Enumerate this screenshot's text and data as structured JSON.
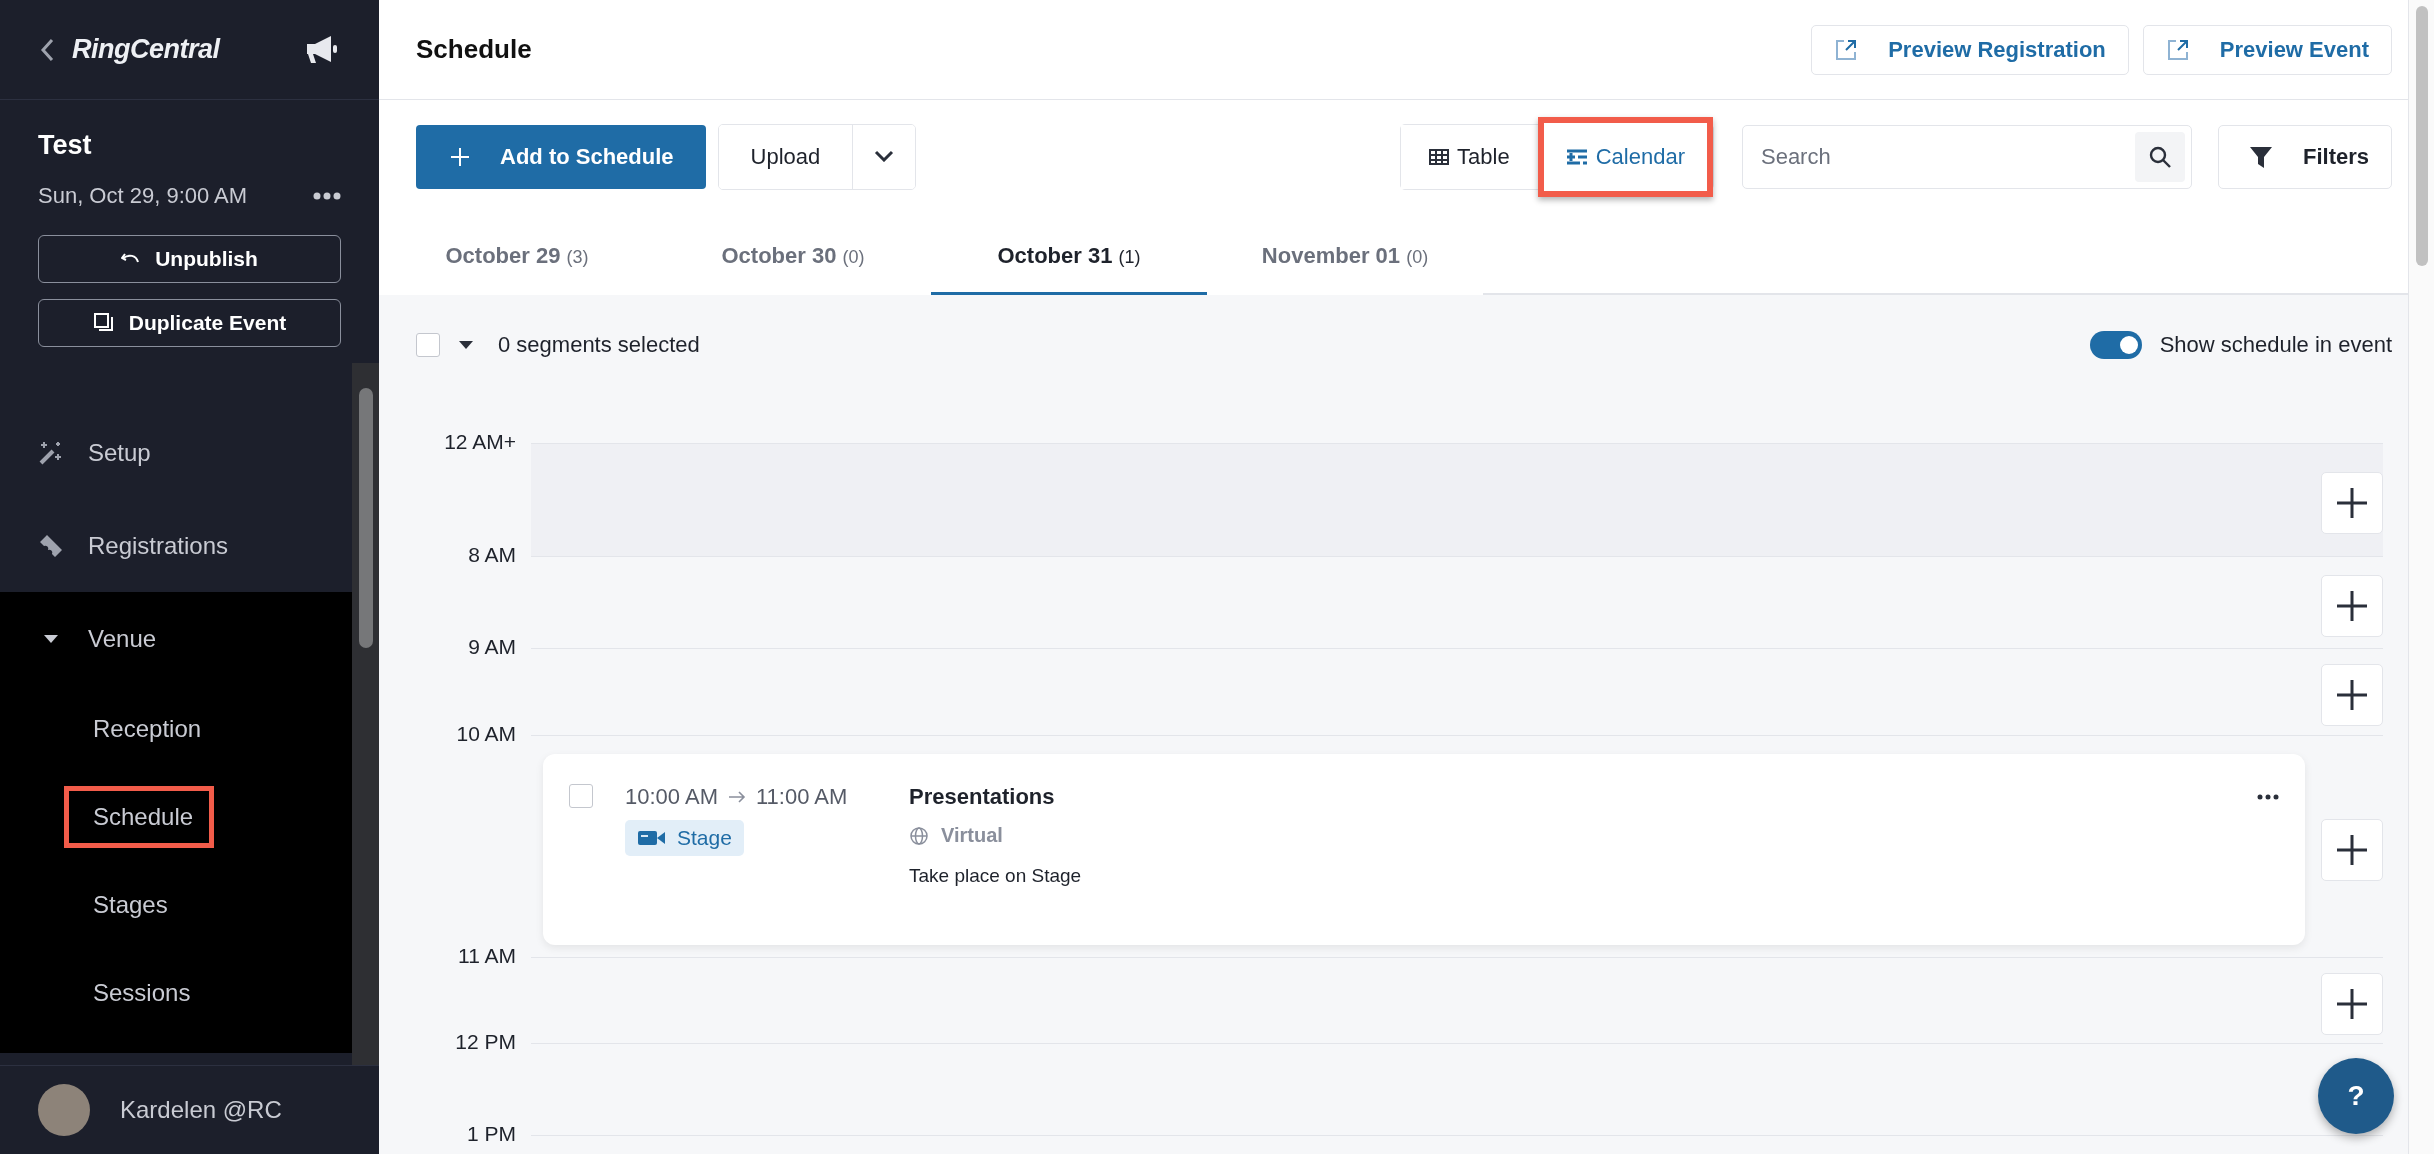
{
  "sidebar": {
    "brand": "RingCentral",
    "event_title": "Test",
    "event_date": "Sun, Oct 29, 9:00 AM",
    "actions": [
      {
        "label": "Unpublish",
        "kind": "undo"
      },
      {
        "label": "Duplicate Event",
        "kind": "duplicate"
      }
    ],
    "nav": [
      {
        "label": "Setup",
        "kind": "wand"
      },
      {
        "label": "Registrations",
        "kind": "ticket"
      },
      {
        "label": "Venue",
        "kind": "group",
        "expanded": true,
        "children": [
          {
            "label": "Reception",
            "annotated": false
          },
          {
            "label": "Schedule",
            "annotated": true
          },
          {
            "label": "Stages",
            "annotated": false
          },
          {
            "label": "Sessions",
            "annotated": false
          }
        ]
      }
    ],
    "user": {
      "name": "Kardelen @RC"
    }
  },
  "header": {
    "title": "Schedule",
    "links": [
      "Preview Registration",
      "Preview Event"
    ]
  },
  "toolbar": {
    "add_button": "Add to Schedule",
    "upload_button": "Upload",
    "views": [
      {
        "label": "Table",
        "kind": "table",
        "selected": false,
        "annotated": false
      },
      {
        "label": "Calendar",
        "kind": "calendar",
        "selected": true,
        "annotated": true
      }
    ],
    "search": {
      "placeholder": "Search"
    },
    "filters_button": "Filters"
  },
  "date_tabs": [
    {
      "label": "October 29",
      "count": "(3)",
      "selected": false
    },
    {
      "label": "October 30",
      "count": "(0)",
      "selected": false
    },
    {
      "label": "October 31",
      "count": "(1)",
      "selected": true
    },
    {
      "label": "November 01",
      "count": "(0)",
      "selected": false
    }
  ],
  "selection": {
    "checked": false,
    "summary": "0 segments selected"
  },
  "show_schedule_toggle": {
    "label": "Show schedule in event",
    "on": true
  },
  "calendar": {
    "rows": [
      {
        "label": "12 AM+",
        "shaded": true,
        "add_button": true,
        "events": []
      },
      {
        "label": "8 AM",
        "shaded": false,
        "add_button": true,
        "events": []
      },
      {
        "label": "9 AM",
        "shaded": false,
        "add_button": true,
        "events": []
      },
      {
        "label": "10 AM",
        "shaded": false,
        "add_button": true,
        "events": [
          {
            "checked": false,
            "start": "10:00 AM",
            "end": "11:00 AM",
            "location": "Stage",
            "title": "Presentations",
            "mode": "Virtual",
            "description": "Take place on Stage"
          }
        ]
      },
      {
        "label": "11 AM",
        "shaded": false,
        "add_button": true,
        "events": []
      },
      {
        "label": "12 PM",
        "shaded": false,
        "add_button": false,
        "events": []
      },
      {
        "label": "1 PM",
        "shaded": false,
        "add_button": false,
        "events": []
      }
    ]
  },
  "help_button": "?"
}
